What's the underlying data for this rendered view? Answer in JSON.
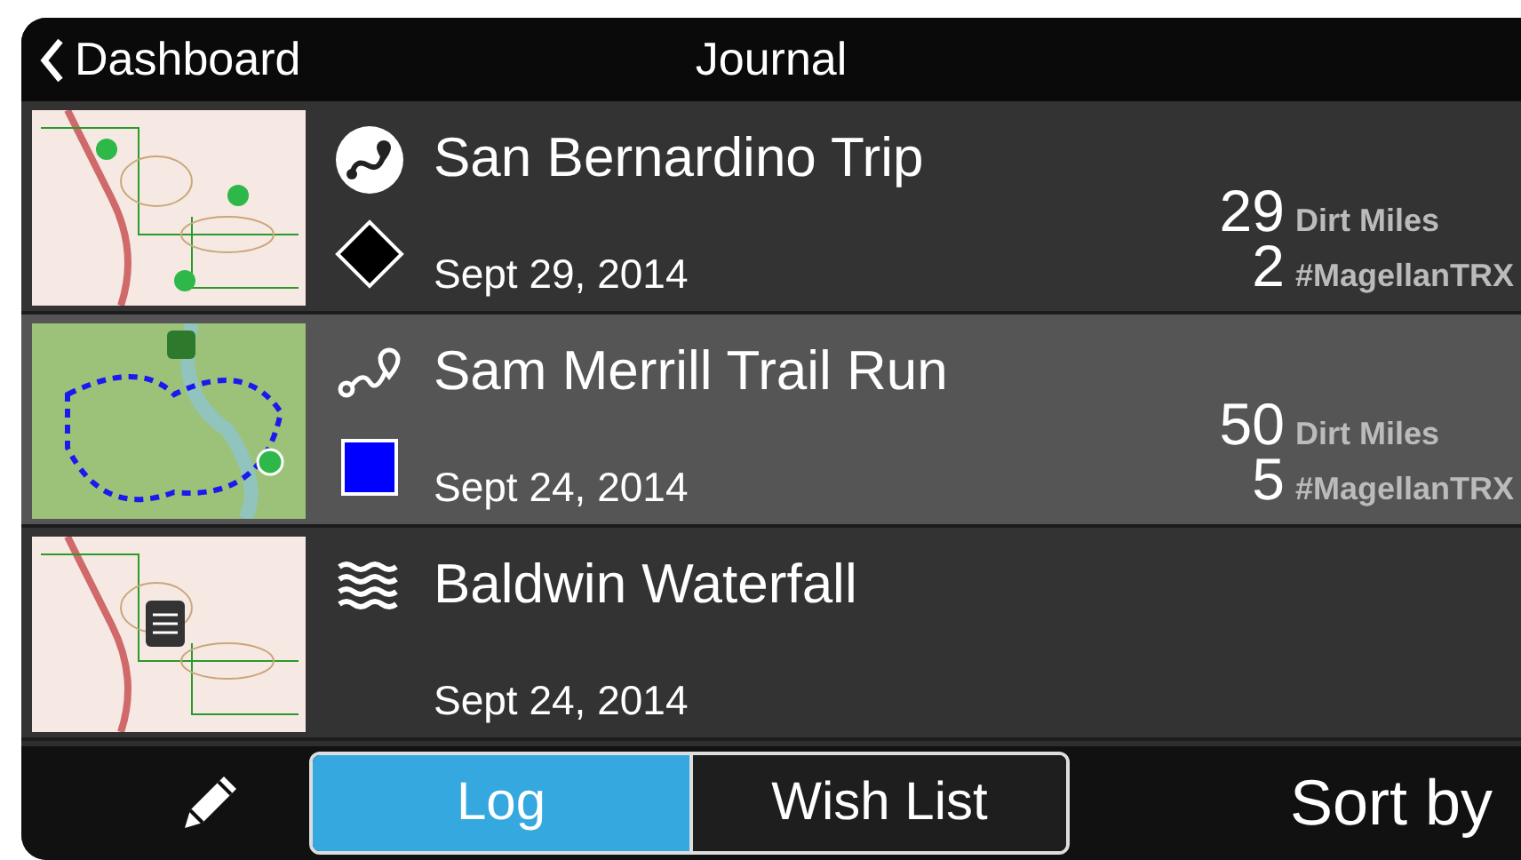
{
  "header": {
    "back_label": "Dashboard",
    "title": "Journal"
  },
  "entries": [
    {
      "title": "San Bernardino Trip",
      "date": "Sept 29, 2014",
      "marker": {
        "kind": "diamond",
        "color": "#000000"
      },
      "selected": false,
      "miles": "29",
      "miles_label": "Dirt Miles",
      "tags": "2",
      "tag_label": "#MagellanTRX"
    },
    {
      "title": "Sam Merrill Trail Run",
      "date": "Sept 24, 2014",
      "marker": {
        "kind": "square",
        "color": "#0000ff"
      },
      "selected": true,
      "miles": "50",
      "miles_label": "Dirt Miles",
      "tags": "5",
      "tag_label": "#MagellanTRX"
    },
    {
      "title": "Baldwin Waterfall",
      "date": "Sept 24, 2014",
      "selected": false
    }
  ],
  "toolbar": {
    "segments": [
      {
        "label": "Log",
        "selected": true
      },
      {
        "label": "Wish List",
        "selected": false
      }
    ],
    "sort_label": "Sort by"
  }
}
